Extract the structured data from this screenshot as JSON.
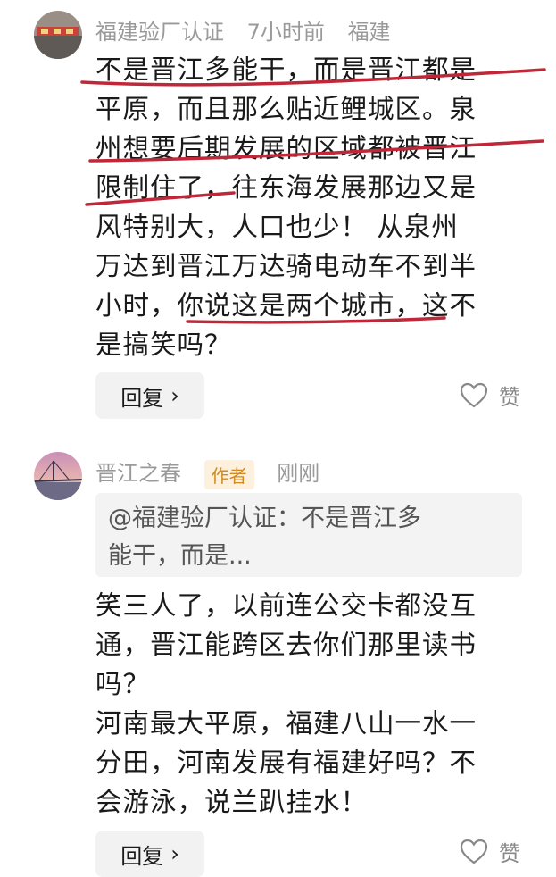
{
  "comments": [
    {
      "username": "福建验厂认证",
      "time": "7小时前",
      "location": "福建",
      "lines": [
        "不是晋江多能干，而是晋江都是",
        "平原，而且那么贴近鲤城区。泉",
        "州想要后期发展的区域都被晋江",
        "限制住了，往东海发展那边又是",
        "风特别大，人口也少！ 从泉州",
        "万达到晋江万达骑电动车不到半",
        "小时，你说这是两个城市，这不",
        "是搞笑吗？"
      ],
      "reply_label": "回复",
      "like_label": "赞"
    },
    {
      "username": "晋江之春",
      "badge": "作者",
      "time": "刚刚",
      "quote_lines": [
        "@福建验厂认证：不是晋江多",
        "能干，而是..."
      ],
      "lines": [
        "笑三人了，以前连公交卡都没互",
        "通，晋江能跨区去你们那里读书",
        "吗？",
        "河南最大平原，福建八山一水一",
        "分田，河南发展有福建好吗？不",
        "会游泳，说兰趴挂水！"
      ],
      "reply_label": "回复",
      "like_label": "赞"
    }
  ],
  "colors": {
    "underline": "#c0283a",
    "badge_text": "#d28a1f",
    "meta": "#9a9a9a"
  }
}
